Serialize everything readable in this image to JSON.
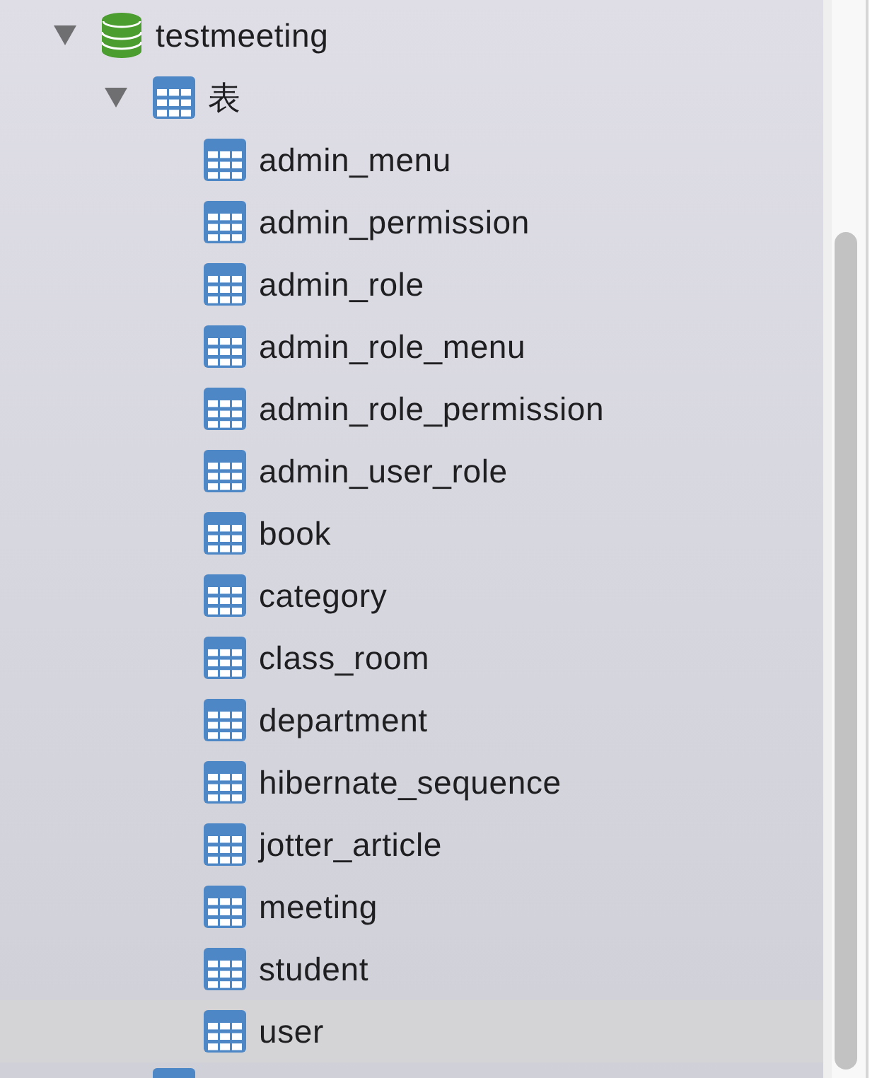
{
  "tree": [
    {
      "label": "testmeeting",
      "kind": "database",
      "expanded": true,
      "selected": false,
      "children": [
        {
          "label": "表",
          "kind": "table_group",
          "expanded": true,
          "selected": false,
          "children": [
            {
              "label": "admin_menu",
              "kind": "table",
              "selected": false
            },
            {
              "label": "admin_permission",
              "kind": "table",
              "selected": false
            },
            {
              "label": "admin_role",
              "kind": "table",
              "selected": false
            },
            {
              "label": "admin_role_menu",
              "kind": "table",
              "selected": false
            },
            {
              "label": "admin_role_permission",
              "kind": "table",
              "selected": false
            },
            {
              "label": "admin_user_role",
              "kind": "table",
              "selected": false
            },
            {
              "label": "book",
              "kind": "table",
              "selected": false
            },
            {
              "label": "category",
              "kind": "table",
              "selected": false
            },
            {
              "label": "class_room",
              "kind": "table",
              "selected": false
            },
            {
              "label": "department",
              "kind": "table",
              "selected": false
            },
            {
              "label": "hibernate_sequence",
              "kind": "table",
              "selected": false
            },
            {
              "label": "jotter_article",
              "kind": "table",
              "selected": false
            },
            {
              "label": "meeting",
              "kind": "table",
              "selected": false
            },
            {
              "label": "student",
              "kind": "table",
              "selected": false
            },
            {
              "label": "user",
              "kind": "table",
              "selected": true
            }
          ]
        },
        {
          "kind": "table_group",
          "selected": false
        }
      ]
    }
  ]
}
